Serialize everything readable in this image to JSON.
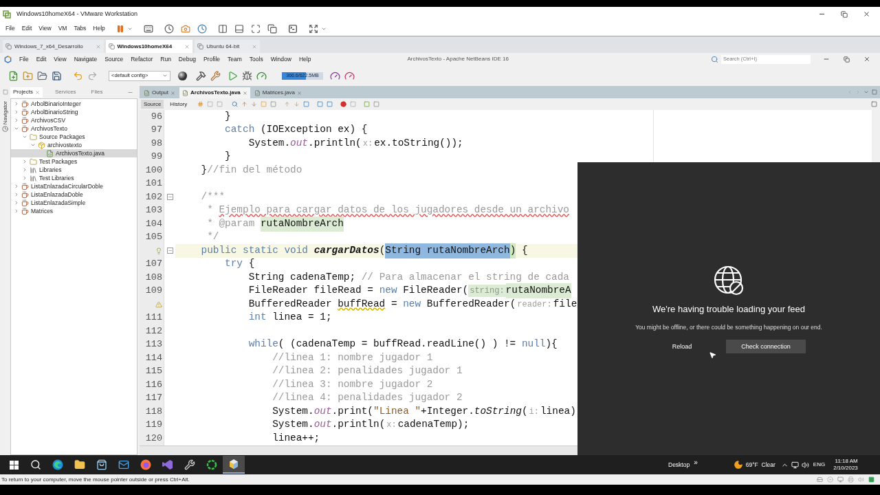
{
  "vmware": {
    "title": "Windows10homeX64 - VMware Workstation",
    "menu": [
      "File",
      "Edit",
      "View",
      "VM",
      "Tabs",
      "Help"
    ],
    "tabs": [
      {
        "label": "Windows_7_x64_Desarrollo",
        "selected": false
      },
      {
        "label": "Windows10homeX64",
        "selected": true
      },
      {
        "label": "Ubuntu 64-bit",
        "selected": false
      }
    ],
    "status": "To return to your computer, move the mouse pointer outside or press Ctrl+Alt."
  },
  "ide": {
    "title": "ArchivosTexto - Apache NetBeans IDE 16",
    "menu": [
      "File",
      "Edit",
      "View",
      "Navigate",
      "Source",
      "Refactor",
      "Run",
      "Debug",
      "Profile",
      "Team",
      "Tools",
      "Window",
      "Help"
    ],
    "search": {
      "placeholder": "Search (Ctrl+I)"
    },
    "config": {
      "value": "<default config>"
    },
    "memory": {
      "reading": "366.6/622.5MB",
      "level": 0.59
    },
    "side_tabs": [
      {
        "label": "Projects",
        "selected": true,
        "closable": true
      },
      {
        "label": "Services",
        "selected": false,
        "closable": false
      },
      {
        "label": "Files",
        "selected": false,
        "closable": false
      }
    ],
    "navigator": "Navigator",
    "tree": [
      {
        "label": "ArbolBinarioInteger",
        "kind": "project",
        "expanded": false,
        "selected": false
      },
      {
        "label": "ArbolBinarioString",
        "kind": "project",
        "expanded": false,
        "selected": false
      },
      {
        "label": "ArchivosCSV",
        "kind": "project",
        "expanded": false,
        "selected": false
      },
      {
        "label": "ArchivosTexto",
        "kind": "project",
        "expanded": true,
        "selected": false,
        "children": [
          {
            "label": "Source Packages",
            "kind": "folder",
            "expanded": true,
            "selected": false,
            "children": [
              {
                "label": "archivostexto",
                "kind": "package",
                "expanded": true,
                "selected": false,
                "children": [
                  {
                    "label": "ArchivosTexto.java",
                    "kind": "file",
                    "selected": true
                  }
                ]
              }
            ]
          },
          {
            "label": "Test Packages",
            "kind": "folder",
            "expanded": false,
            "selected": false
          },
          {
            "label": "Libraries",
            "kind": "library",
            "expanded": false,
            "selected": false
          },
          {
            "label": "Test Libraries",
            "kind": "library",
            "expanded": false,
            "selected": false
          }
        ]
      },
      {
        "label": "ListaEnlazadaCircularDoble",
        "kind": "project",
        "expanded": false,
        "selected": false
      },
      {
        "label": "ListaEnlazadaDoble",
        "kind": "project",
        "expanded": false,
        "selected": false
      },
      {
        "label": "ListaEnlazadaSimple",
        "kind": "project",
        "expanded": false,
        "selected": false
      },
      {
        "label": "Matrices",
        "kind": "project",
        "expanded": false,
        "selected": false
      }
    ],
    "editor_tabs": [
      {
        "label": "Output",
        "selected": false
      },
      {
        "label": "ArchivosTexto.java",
        "selected": true
      },
      {
        "label": "Matrices.java",
        "selected": false
      }
    ],
    "views": [
      {
        "label": "Source",
        "selected": true
      },
      {
        "label": "History",
        "selected": false
      }
    ],
    "lines": [
      {
        "number": "96",
        "segments": [
          {
            "kind": "plain",
            "text": "        }"
          }
        ]
      },
      {
        "number": "97",
        "segments": [
          {
            "kind": "keyword",
            "text": "        catch"
          },
          {
            "kind": "plain",
            "text": " (IOException ex) {"
          }
        ]
      },
      {
        "number": "98",
        "segments": [
          {
            "kind": "plain",
            "text": "            System."
          },
          {
            "kind": "field",
            "text": "out"
          },
          {
            "kind": "plain",
            "text": ".println("
          },
          {
            "kind": "hint",
            "text": "x:"
          },
          {
            "kind": "plain",
            "text": "ex.toString());"
          }
        ]
      },
      {
        "number": "99",
        "segments": [
          {
            "kind": "plain",
            "text": "        }"
          }
        ]
      },
      {
        "number": "100",
        "segments": [
          {
            "kind": "plain",
            "text": "    }"
          },
          {
            "kind": "comment",
            "text": "//fin del método"
          }
        ]
      },
      {
        "number": "101"
      },
      {
        "number": "102",
        "fold": true,
        "segments": [
          {
            "kind": "comment",
            "text": "    /***"
          }
        ]
      },
      {
        "number": "103",
        "segments": [
          {
            "kind": "comment",
            "text": "     * "
          },
          {
            "kind": "spell",
            "text": "Ejemplo para cargar datos de los jugadores desde un archivo"
          }
        ]
      },
      {
        "number": "104",
        "segments": [
          {
            "kind": "comment",
            "text": "     * @param "
          },
          {
            "kind": "param",
            "text": "rutaNombreArch"
          }
        ]
      },
      {
        "number": "105",
        "segments": [
          {
            "kind": "comment",
            "text": "     */"
          }
        ]
      },
      {
        "bulb": true,
        "fold": true,
        "current": true,
        "segments": [
          {
            "kind": "keyword",
            "text": "    public static void"
          },
          {
            "kind": "method",
            "text": " cargarDatos"
          },
          {
            "kind": "plain",
            "text": "("
          },
          {
            "kind": "selected",
            "text": "String rutaNombreArch"
          },
          {
            "kind": "match",
            "text": ")"
          },
          {
            "kind": "plain",
            "text": " {"
          }
        ]
      },
      {
        "number": "107",
        "segments": [
          {
            "kind": "keyword",
            "text": "        try"
          },
          {
            "kind": "plain",
            "text": " {"
          }
        ]
      },
      {
        "number": "108",
        "segments": [
          {
            "kind": "plain",
            "text": "            String cadenaTemp; "
          },
          {
            "kind": "comment",
            "text": "// Para almacenar el string de cada"
          }
        ]
      },
      {
        "number": "109",
        "segments": [
          {
            "kind": "plain",
            "text": "            FileReader fileRead = "
          },
          {
            "kind": "keyword",
            "text": "new"
          },
          {
            "kind": "plain",
            "text": " FileReader("
          },
          {
            "kind": "hint-ok",
            "text": "string:"
          },
          {
            "kind": "param",
            "text": "rutaNombreA"
          }
        ]
      },
      {
        "warning": true,
        "segments": [
          {
            "kind": "plain",
            "text": "            BufferedReader "
          },
          {
            "kind": "warn",
            "text": "buffRead"
          },
          {
            "kind": "plain",
            "text": " = "
          },
          {
            "kind": "keyword",
            "text": "new"
          },
          {
            "kind": "plain",
            "text": " BufferedReader("
          },
          {
            "kind": "hint",
            "text": "reader:"
          },
          {
            "kind": "plain",
            "text": "file"
          }
        ]
      },
      {
        "number": "111",
        "segments": [
          {
            "kind": "keyword",
            "text": "            int"
          },
          {
            "kind": "plain",
            "text": " linea = 1;"
          }
        ]
      },
      {
        "number": "112"
      },
      {
        "number": "113",
        "segments": [
          {
            "kind": "keyword",
            "text": "            while"
          },
          {
            "kind": "plain",
            "text": "( (cadenaTemp = buffRead.readLine() ) != "
          },
          {
            "kind": "keyword",
            "text": "null"
          },
          {
            "kind": "plain",
            "text": "){"
          }
        ]
      },
      {
        "number": "114",
        "segments": [
          {
            "kind": "comment",
            "text": "                //linea 1: nombre jugador 1"
          }
        ]
      },
      {
        "number": "115",
        "segments": [
          {
            "kind": "comment",
            "text": "                //linea 2: penalidades jugador 1"
          }
        ]
      },
      {
        "number": "116",
        "segments": [
          {
            "kind": "comment",
            "text": "                //linea 3: nombre jugador 2"
          }
        ]
      },
      {
        "number": "117",
        "segments": [
          {
            "kind": "comment",
            "text": "                //linea 4: penalidades jugador 2"
          }
        ]
      },
      {
        "number": "118",
        "segments": [
          {
            "kind": "plain",
            "text": "                System."
          },
          {
            "kind": "field",
            "text": "out"
          },
          {
            "kind": "plain",
            "text": ".print("
          },
          {
            "kind": "string",
            "text": "\"Linea \""
          },
          {
            "kind": "plain",
            "text": "+Integer."
          },
          {
            "kind": "italic",
            "text": "toString"
          },
          {
            "kind": "plain",
            "text": "("
          },
          {
            "kind": "hint",
            "text": "i:"
          },
          {
            "kind": "plain",
            "text": "linea)"
          }
        ]
      },
      {
        "number": "119",
        "segments": [
          {
            "kind": "plain",
            "text": "                System."
          },
          {
            "kind": "field",
            "text": "out"
          },
          {
            "kind": "plain",
            "text": ".println("
          },
          {
            "kind": "hint",
            "text": "x:"
          },
          {
            "kind": "plain",
            "text": "cadenaTemp);"
          }
        ]
      },
      {
        "number": "120",
        "segments": [
          {
            "kind": "plain",
            "text": "                linea++;"
          }
        ]
      }
    ]
  },
  "feed_panel": {
    "title": "We're having trouble loading your feed",
    "message": "You might be offline, or there could be something happening on our end.",
    "buttons": [
      {
        "label": "Reload",
        "kind": "link"
      },
      {
        "label": "Check connection",
        "kind": "primary"
      }
    ]
  },
  "taskbar": {
    "apps": [
      {
        "kind": "start",
        "selected": false
      },
      {
        "kind": "search",
        "selected": false
      },
      {
        "kind": "edge",
        "selected": false
      },
      {
        "kind": "explorer",
        "selected": false
      },
      {
        "kind": "store",
        "selected": false
      },
      {
        "kind": "mail",
        "selected": false
      },
      {
        "kind": "firefox",
        "selected": false
      },
      {
        "kind": "vs",
        "selected": false
      },
      {
        "kind": "tools",
        "selected": false
      },
      {
        "kind": "ring",
        "selected": false
      },
      {
        "kind": "netbeans",
        "selected": true
      }
    ],
    "desktop": "Desktop",
    "more": "»",
    "weather": "69°F  Clear",
    "language": "ENG",
    "time": "11:18 AM",
    "date": "2/10/2023"
  }
}
